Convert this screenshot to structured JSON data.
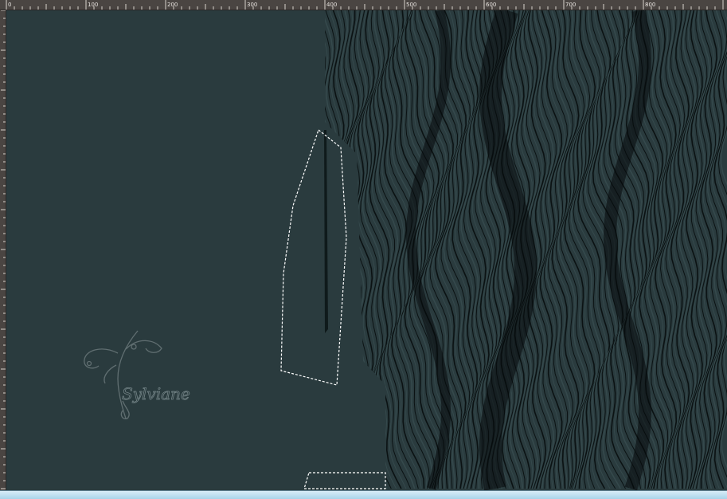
{
  "ruler": {
    "labels": [
      "0",
      "100",
      "200",
      "300",
      "400",
      "500",
      "600",
      "700",
      "800"
    ]
  },
  "watermark": {
    "text": "Sylviane"
  },
  "colors": {
    "canvas_bg": "#2a3b3e",
    "ruler_bg": "#4a4542",
    "stripe_dark": "#0b1213",
    "stripe_light": "#35494c",
    "selection": "#ffffff",
    "status_strip": "#a9d4ea"
  },
  "icons": [
    "selection-marquee-icon",
    "watermark-signature-icon"
  ]
}
